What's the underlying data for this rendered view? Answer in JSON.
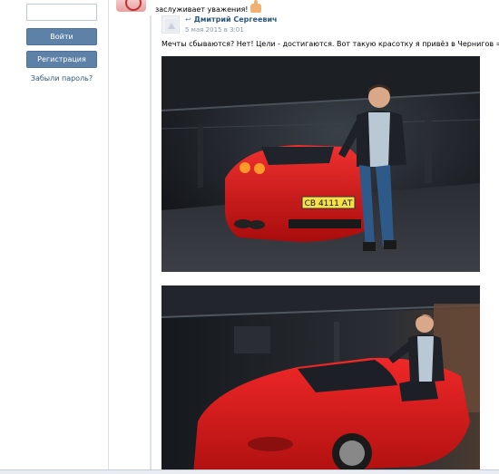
{
  "sidebar": {
    "login_button": "Войти",
    "register_button": "Регистрация",
    "forgot_link": "Забыли пароль?"
  },
  "post": {
    "text_fragment": "заслуживает уважения!"
  },
  "repost": {
    "author": "Дмитрий Сергеевич",
    "date": "5 мая 2015 в 3:01",
    "text": "Мечты сбываются? Нет! Цели - достигаются. Вот такую красотку я привёз в Чернигов =)"
  },
  "photos": {
    "photo1_plate": "СВ 4111 АТ"
  },
  "icons": {
    "repost": "repost-arrow-icon",
    "thumbs_up": "thumbs-up-icon"
  },
  "colors": {
    "link": "#2b587a",
    "button": "#5e81a8",
    "car_red": "#d01818"
  }
}
